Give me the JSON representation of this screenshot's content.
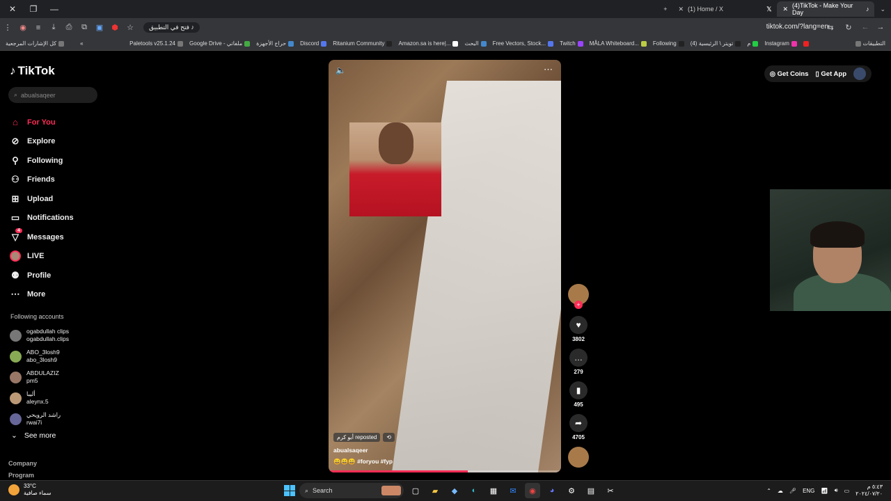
{
  "browser": {
    "tabs": [
      {
        "label": "(1) Home / X"
      },
      {
        "label": "(4)TikTok - Make Your Day",
        "active": true
      }
    ],
    "new_tab": "+",
    "open_in_app": "فتح في التطبيق",
    "url": "tiktok.com/?lang=en",
    "bookmarks_left": "كل الإشارات المرجعية",
    "bookmarks": [
      "Paletools v25.1.24",
      "Google Drive - ملفاتي",
      "حراج الأجهزة",
      "Discord",
      "Ritanium Community",
      "Amazon.sa is here|...",
      "البحث",
      "Free Vectors, Stock...",
      "Twitch",
      "MÅLA Whiteboard...",
      "Following",
      "(4) تويتر \\ الرئيسية",
      "م",
      "Instagram"
    ],
    "bookmarks_right": "التطبيقات"
  },
  "sidebar": {
    "logo": "TikTok",
    "search_placeholder": "abualsaqeer",
    "nav": [
      {
        "label": "For You",
        "icon": "home-icon",
        "active": true
      },
      {
        "label": "Explore",
        "icon": "compass-icon"
      },
      {
        "label": "Following",
        "icon": "following-icon"
      },
      {
        "label": "Friends",
        "icon": "friends-icon"
      },
      {
        "label": "Upload",
        "icon": "upload-icon"
      },
      {
        "label": "Notifications",
        "icon": "notifications-icon"
      },
      {
        "label": "Messages",
        "icon": "messages-icon",
        "badge": "4"
      },
      {
        "label": "LIVE",
        "icon": "live-icon"
      },
      {
        "label": "Profile",
        "icon": "profile-icon"
      },
      {
        "label": "More",
        "icon": "more-icon"
      }
    ],
    "following_title": "Following accounts",
    "following": [
      {
        "name": "ogabdullah clips",
        "handle": "ogabdullah.clips"
      },
      {
        "name": "ABO_3losh9",
        "handle": "abo_3losh9"
      },
      {
        "name": "ABDULAZIZ",
        "handle": "pm5"
      },
      {
        "name": "أليبا",
        "handle": "aleynx.5"
      },
      {
        "name": "راشد الرويحي",
        "handle": "rwai7i"
      }
    ],
    "see_more": "See more",
    "footer": [
      "Company",
      "Program"
    ]
  },
  "video": {
    "repost": "أبو كرم reposted",
    "author": "abualsaqeer",
    "caption": "😄😄😄 #foryou #fyp",
    "progress": 0.6
  },
  "actions": {
    "likes": "3802",
    "comments": "279",
    "saves": "495",
    "shares": "4705"
  },
  "header": {
    "get_coins": "Get Coins",
    "get_app": "Get App"
  },
  "taskbar": {
    "temp": "33°C",
    "weather": "سماء صافية",
    "search": "Search",
    "lang": "ENG",
    "time": "٥:٤٣ م",
    "date": "٢٠٢٤/٠٧/٢٠"
  }
}
